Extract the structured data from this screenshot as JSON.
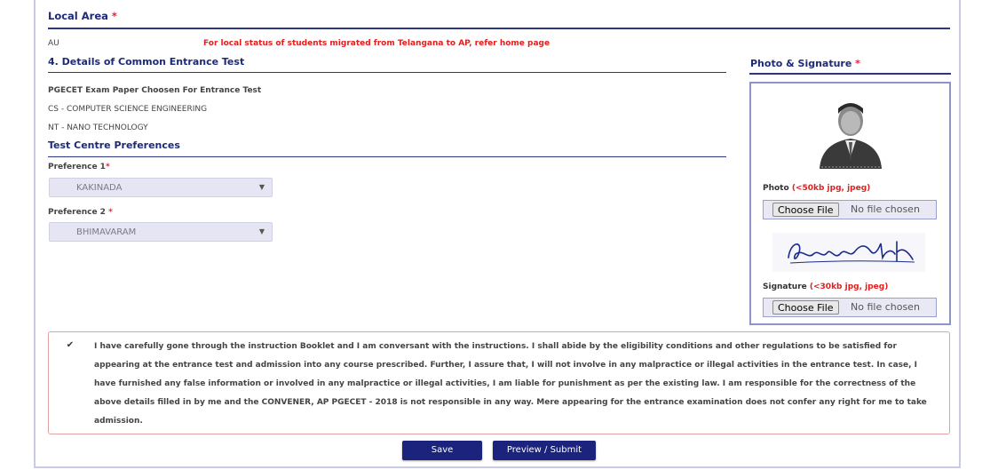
{
  "local_area": {
    "title": "Local Area",
    "required_mark": "*",
    "value": "AU",
    "note": "For local status of students migrated from Telangana to AP, refer home page"
  },
  "cet": {
    "title": "4. Details of Common Entrance Test",
    "exam_paper_label": "PGECET Exam Paper Choosen For Entrance Test",
    "papers": [
      "CS - COMPUTER SCIENCE ENGINEERING",
      "NT - NANO TECHNOLOGY"
    ]
  },
  "centres": {
    "title": "Test Centre Preferences",
    "pref1_label": "Preference 1",
    "pref1_required": "*",
    "pref1_value": "KAKINADA",
    "pref2_label": "Preference 2",
    "pref2_required": "*",
    "pref2_value": "BHIMAVARAM"
  },
  "photo_signature": {
    "title": "Photo & Signature",
    "required_mark": "*",
    "photo_label": "Photo",
    "photo_hint": "(<50kb jpg, jpeg)",
    "signature_label": "Signature",
    "signature_hint": "(<30kb jpg, jpeg)",
    "choose_file": "Choose File",
    "no_file": "No file chosen"
  },
  "declaration": {
    "checked": true,
    "check_glyph": "✔",
    "text": "I have carefully gone through the instruction Booklet and I am conversant with the instructions. I shall abide by the eligibility conditions and other regulations to be satisfied for appearing at the entrance test and admission into any course prescribed. Further, I assure that, I will not involve in any malpractice or illegal activities in the entrance test. In case, I have furnished any false information or involved in any malpractice or illegal activities, I am liable for punishment as per the existing law. I am responsible for the correctness of the above details filled in by me and the CONVENER, AP PGECET - 2018 is not responsible in any way. Mere appearing for the entrance examination does not confer any right for me to take admission."
  },
  "actions": {
    "save": "Save",
    "preview_submit": "Preview / Submit"
  },
  "colors": {
    "heading": "#1d2a78",
    "required": "#e21f3a",
    "button": "#1c237d"
  }
}
